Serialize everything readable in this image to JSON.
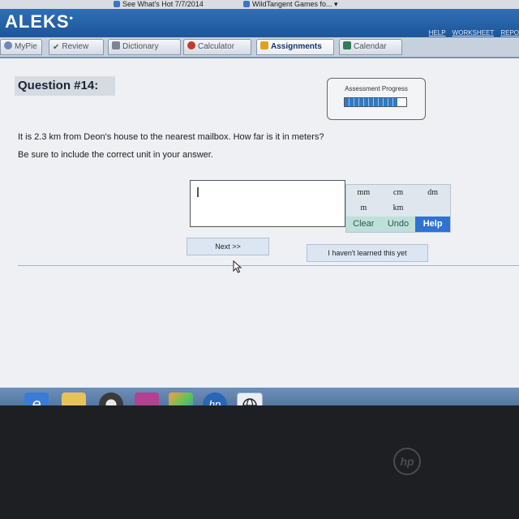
{
  "browser": {
    "tabs": [
      "See What's Hot 7/7/2014",
      "WildTangent Games fo..."
    ]
  },
  "header": {
    "logo": "ALEKS",
    "links": [
      "HELP",
      "WORKSHEET",
      "REPO"
    ]
  },
  "nav": {
    "tabs": [
      {
        "label": "MyPie",
        "icon": "pie-icon"
      },
      {
        "label": "Review",
        "icon": "check-icon"
      },
      {
        "label": "Dictionary",
        "icon": "book-icon"
      },
      {
        "label": "Calculator",
        "icon": "calculator-icon"
      },
      {
        "label": "Assignments",
        "icon": "assignment-icon",
        "active": true
      },
      {
        "label": "Calendar",
        "icon": "calendar-icon"
      }
    ]
  },
  "question": {
    "title": "Question #14:",
    "progress_label": "Assessment Progress",
    "progress_value": 0.85,
    "text": "It is 2.3 km from Deon's house to the nearest mailbox. How far is it in meters?",
    "instruction": "Be sure to include the correct unit in your answer.",
    "answer_value": ""
  },
  "unit_palette": {
    "units": [
      "mm",
      "cm",
      "dm",
      "m",
      "km",
      ""
    ],
    "clear": "Clear",
    "undo": "Undo",
    "help": "Help"
  },
  "buttons": {
    "next": "Next >>",
    "not_learned": "I haven't learned this yet"
  },
  "taskbar": {
    "items": [
      "internet-explorer-icon",
      "folder-icon",
      "media-player-icon",
      "settings-icon",
      "photo-icon",
      "hp-icon",
      "globe-icon"
    ]
  },
  "colors": {
    "header": "#1d5598",
    "help_button": "#2f72d2",
    "tool_buttons": "#bfe0d8"
  }
}
